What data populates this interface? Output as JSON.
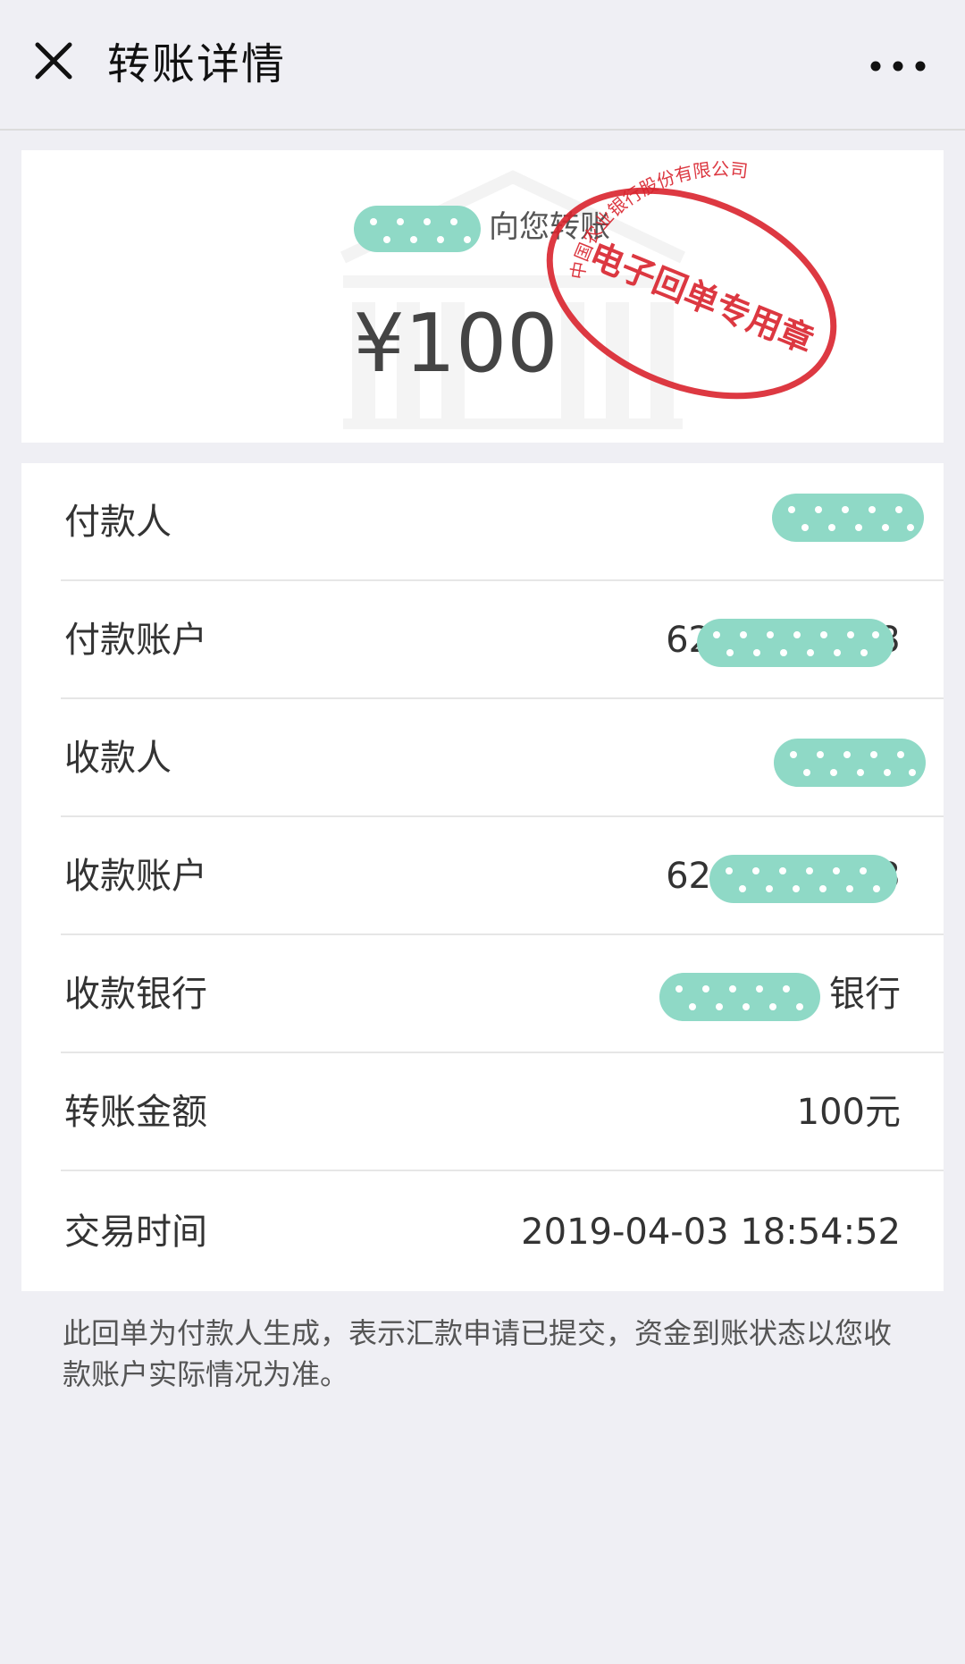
{
  "header": {
    "title": "转账详情",
    "close_icon": "close-icon",
    "more_icon": "more-horizontal-icon"
  },
  "summary": {
    "sender_text": "向您转账",
    "amount": "¥100",
    "stamp_top_text": "中国农业银行股份有限公司",
    "stamp_center_text": "电子回单专用章",
    "stamp_color": "#d9232d",
    "mask_color": "#8fd9c6"
  },
  "details": {
    "rows": [
      {
        "label": "付款人",
        "value": ""
      },
      {
        "label": "付款账户",
        "value": "62",
        "value_suffix": "3"
      },
      {
        "label": "收款人",
        "value": ""
      },
      {
        "label": "收款账户",
        "value": "62",
        "value_suffix": "3"
      },
      {
        "label": "收款银行",
        "value": "银行"
      },
      {
        "label": "转账金额",
        "value": "100元"
      },
      {
        "label": "交易时间",
        "value": "2019-04-03 18:54:52"
      }
    ]
  },
  "footnote": "此回单为付款人生成，表示汇款申请已提交，资金到账状态以您收款账户实际情况为准。"
}
